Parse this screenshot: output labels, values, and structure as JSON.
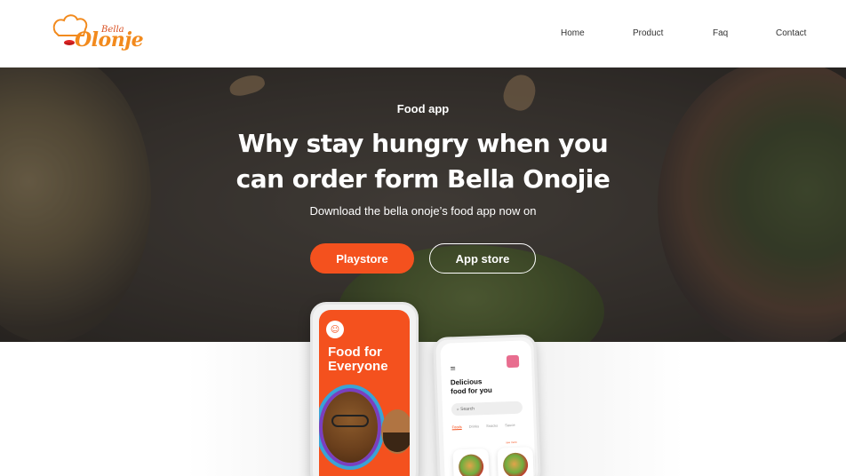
{
  "header": {
    "logo": {
      "brand_small": "Bella",
      "brand_big": "Olonje"
    },
    "nav": [
      {
        "label": "Home"
      },
      {
        "label": "Product"
      },
      {
        "label": "Faq"
      },
      {
        "label": "Contact"
      }
    ]
  },
  "hero": {
    "kicker": "Food app",
    "title_line1": "Why stay hungry when you",
    "title_line2": "can order form Bella Onojie",
    "subtitle": "Download the bella onoje’s food app now on",
    "buttons": {
      "playstore": "Playstore",
      "appstore": "App store"
    }
  },
  "phones": {
    "phone1": {
      "title_line1": "Food for",
      "title_line2": "Everyone"
    },
    "phone2": {
      "title_line1": "Delicious",
      "title_line2": "food for you",
      "search_placeholder": "Search",
      "tabs": [
        "Foods",
        "Drinks",
        "Snacks",
        "Sauce"
      ],
      "see_more": "see more"
    }
  },
  "colors": {
    "accent": "#f4511e",
    "logo_orange": "#f28a1d",
    "logo_red": "#d94e1f",
    "hero_overlay": "#3d3834"
  }
}
